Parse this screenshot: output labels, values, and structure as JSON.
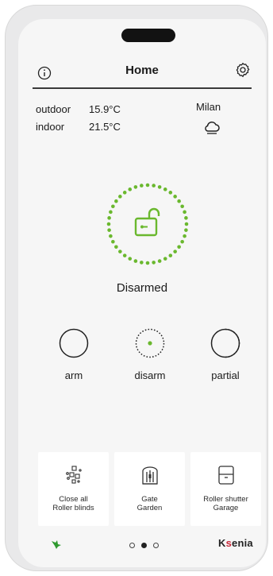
{
  "header": {
    "title": "Home",
    "info_icon": "info-icon",
    "settings_icon": "gear-icon"
  },
  "weather": {
    "outdoor_label": "outdoor",
    "outdoor_temp": "15.9°C",
    "indoor_label": "indoor",
    "indoor_temp": "21.5°C",
    "city": "Milan",
    "condition_icon": "cloud-icon"
  },
  "alarm": {
    "status": "Disarmed",
    "icon": "unlocked-padlock-icon",
    "accent_color": "#6ab82e"
  },
  "actions": [
    {
      "label": "arm"
    },
    {
      "label": "disarm"
    },
    {
      "label": "partial"
    }
  ],
  "shortcuts": [
    {
      "line1": "Close all",
      "line2": "Roller blinds",
      "icon": "roller-blinds-icon"
    },
    {
      "line1": "Gate",
      "line2": "Garden",
      "icon": "gate-icon"
    },
    {
      "line1": "Roller shutter",
      "line2": "Garage",
      "icon": "roller-shutter-icon"
    }
  ],
  "footer": {
    "pages": 3,
    "active_page": 2,
    "brand_prefix": "K",
    "brand_accent": "s",
    "brand_suffix": "enia",
    "left_icon": "green-bird-logo-icon"
  }
}
